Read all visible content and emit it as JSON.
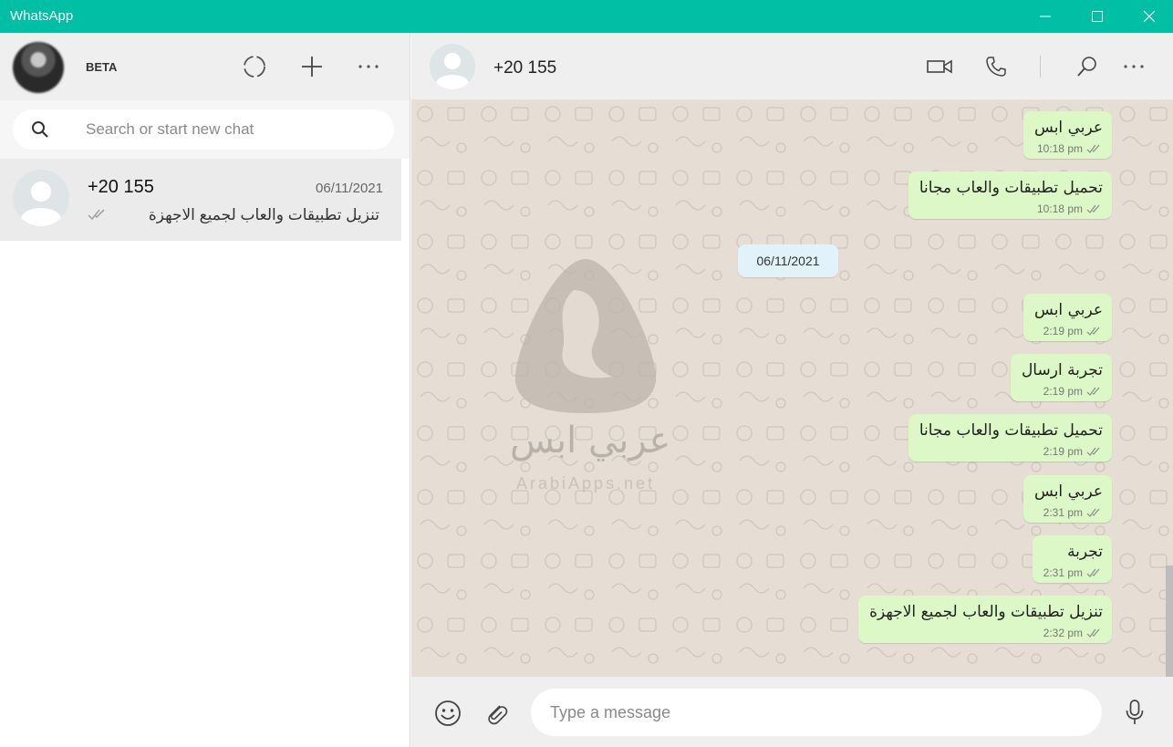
{
  "window": {
    "title": "WhatsApp",
    "accent": "#00bfa5",
    "controls": [
      "minimize-icon",
      "maximize-icon",
      "close-icon"
    ]
  },
  "sidebar": {
    "profile_label": "BETA",
    "header_icons": [
      "status-icon",
      "new-chat-icon",
      "menu-icon"
    ],
    "search": {
      "placeholder": "Search or start new chat"
    },
    "chats": [
      {
        "name": "+20 155",
        "date": "06/11/2021",
        "preview": "تنزيل تطبيقات والعاب لجميع الاجهزة",
        "status": "read"
      }
    ]
  },
  "conversation": {
    "contact_name": "+20 155",
    "header_icons": [
      "video-call-icon",
      "voice-call-icon",
      "search-icon",
      "menu-icon"
    ],
    "watermark": {
      "text": "عربي ابس",
      "sub": "ArabiApps.net"
    },
    "date_separator": "06/11/2021",
    "messages": [
      {
        "text": "عربي ابس",
        "time": "10:18 pm"
      },
      {
        "text": "تحميل تطبيقات والعاب مجانا",
        "time": "10:18 pm"
      },
      {
        "text": "عربي ابس",
        "time": "2:19 pm"
      },
      {
        "text": "تجربة ارسال",
        "time": "2:19 pm"
      },
      {
        "text": "تحميل تطبيقات والعاب مجانا",
        "time": "2:19 pm"
      },
      {
        "text": "عربي ابس",
        "time": "2:31 pm"
      },
      {
        "text": "تجربة",
        "time": "2:31 pm"
      },
      {
        "text": "تنزيل تطبيقات والعاب لجميع الاجهزة",
        "time": "2:32 pm"
      }
    ],
    "bubble_color": "#dcf8c6",
    "composer": {
      "placeholder": "Type a message"
    }
  }
}
